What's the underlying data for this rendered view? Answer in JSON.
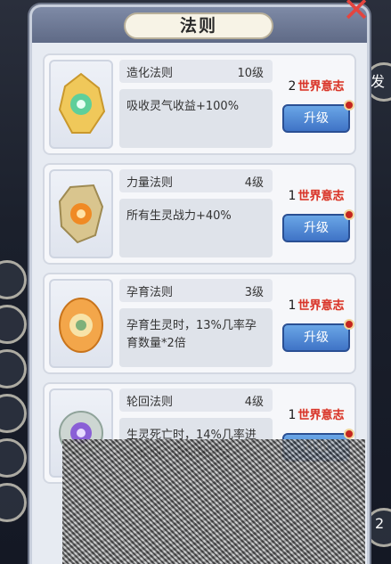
{
  "title": "法则",
  "close_icon": "close-x-icon",
  "button_label": "升级",
  "currency": "世界意志",
  "side_labels": [
    "发",
    "2"
  ],
  "laws": [
    {
      "name": "造化法则",
      "level": "10级",
      "desc": "吸收灵气收益+100%",
      "cost": "2",
      "icon": "creation-law-icon"
    },
    {
      "name": "力量法则",
      "level": "4级",
      "desc": "所有生灵战力+40%",
      "cost": "1",
      "icon": "power-law-icon"
    },
    {
      "name": "孕育法则",
      "level": "3级",
      "desc": "孕育生灵时，13%几率孕育数量*2倍",
      "cost": "1",
      "icon": "nurture-law-icon"
    },
    {
      "name": "轮回法则",
      "level": "4级",
      "desc": "生灵死亡时，14%几率进入轮回，增加其战力",
      "cost": "1",
      "icon": "reincarnation-law-icon"
    }
  ],
  "colors": {
    "currency": "#d8332c",
    "button": "#4f86d6",
    "close": "#e4453f"
  }
}
